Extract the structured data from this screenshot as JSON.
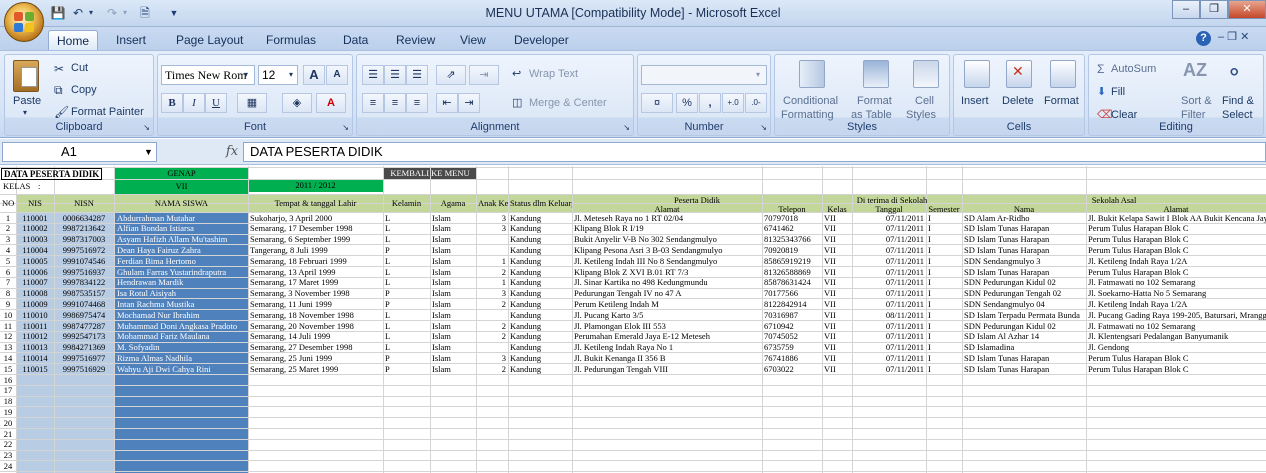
{
  "window": {
    "title": "MENU UTAMA  [Compatibility Mode] - Microsoft Excel",
    "minimize": "–",
    "restore": "❐",
    "close": "✕"
  },
  "ribbon_tabs": [
    "Home",
    "Insert",
    "Page Layout",
    "Formulas",
    "Data",
    "Review",
    "View",
    "Developer"
  ],
  "clipboard": {
    "paste": "Paste",
    "cut": "Cut",
    "copy": "Copy",
    "format_painter": "Format Painter",
    "title": "Clipboard"
  },
  "font": {
    "name": "Times New Rom",
    "size": "12",
    "title": "Font",
    "bold": "B",
    "italic": "I",
    "underline": "U",
    "grow": "A",
    "shrink": "A"
  },
  "alignment": {
    "wrap": "Wrap Text",
    "merge": "Merge & Center",
    "title": "Alignment"
  },
  "number": {
    "title": "Number",
    "percent": "%",
    "comma": ","
  },
  "styles": {
    "conditional": "Conditional",
    "formatting": "Formatting",
    "format_as": "Format",
    "as_table": "as Table",
    "cell": "Cell",
    "styles_lbl": "Styles",
    "title": "Styles"
  },
  "cells": {
    "insert": "Insert",
    "delete": "Delete",
    "format": "Format",
    "title": "Cells"
  },
  "editing": {
    "autosum": "AutoSum",
    "fill": "Fill",
    "clear": "Clear",
    "sort": "Sort &",
    "filter": "Filter",
    "find": "Find &",
    "select": "Select",
    "title": "Editing"
  },
  "formula_bar": {
    "name_box": "A1",
    "fx": "fx",
    "formula": "DATA PESERTA DIDIK"
  },
  "sheet": {
    "title": "DATA PESERTA DIDIK",
    "kelas_label": "KELAS",
    "kelas_colon": ":",
    "genap": "GENAP",
    "vii": "VII",
    "year": "2011 / 2012",
    "kembali": "KEMBALI KE MENU",
    "headers": {
      "no": "NO",
      "nis": "NIS",
      "nisn": "NISN",
      "nama": "NAMA SISWA",
      "ttl": "Tempat & tanggal Lahir",
      "kelamin": "Kelamin",
      "agama": "Agama",
      "anak": "Anak Ke",
      "status": "Status dlm Keluarga",
      "peserta_didik": "Peserta Didik",
      "alamat": "Alamat",
      "telepon": "Telepon",
      "diterima": "Di terima di Sekolah",
      "kelas": "Kelas",
      "tanggal": "Tanggal",
      "semester": "Semester",
      "sekolah_asal": "Sekolah Asal",
      "nama_sekolah": "Nama",
      "alamat_sekolah": "Alamat"
    },
    "rows": [
      {
        "no": "1",
        "nis": "110001",
        "nisn": "0006634287",
        "nama": "Abdurrahman Mutahar",
        "ttl": "Sukoharjo, 3 April 2000",
        "jk": "L",
        "agama": "Islam",
        "anak": "3",
        "status": "Kandung",
        "alamat": "Jl. Meteseh Raya no 1 RT 02/04",
        "telp": "70797018",
        "kelas": "VII",
        "tgl": "07/11/2011",
        "sem": "I",
        "sekolah": "SD Alam Ar-Ridho",
        "alamat_sekolah": "Jl. Bukit Kelapa Sawit I Blok AA Bukit Kencana Jaya"
      },
      {
        "no": "2",
        "nis": "110002",
        "nisn": "9987213642",
        "nama": "Alfian Bondan Istiarsa",
        "ttl": "Semarang, 17 Desember 1998",
        "jk": "L",
        "agama": "Islam",
        "anak": "3",
        "status": "Kandung",
        "alamat": "Klipang Blok R I/19",
        "telp": "6741462",
        "kelas": "VII",
        "tgl": "07/11/2011",
        "sem": "I",
        "sekolah": "SD Islam Tunas Harapan",
        "alamat_sekolah": "Perum Tulus Harapan Blok C"
      },
      {
        "no": "3",
        "nis": "110003",
        "nisn": "9987317003",
        "nama": "Asyam Hafizh Allam Mu'tashim",
        "ttl": "Semarang, 6 September 1999",
        "jk": "L",
        "agama": "Islam",
        "anak": "",
        "status": "Kandung",
        "alamat": "Bukit Anyelir V-B No 302 Sendangmulyo",
        "telp": "81325343766",
        "kelas": "VII",
        "tgl": "07/11/2011",
        "sem": "I",
        "sekolah": "SD Islam Tunas Harapan",
        "alamat_sekolah": "Perum Tulus Harapan Blok C"
      },
      {
        "no": "4",
        "nis": "110004",
        "nisn": "9997516972",
        "nama": "Dean Haya Fairuz Zahra",
        "ttl": "Tangerang, 8 Juli 1999",
        "jk": "P",
        "agama": "Islam",
        "anak": "",
        "status": "Kandung",
        "alamat": "Klipang Pesona Asri 3 B-03 Sendangmulyo",
        "telp": "70920819",
        "kelas": "VII",
        "tgl": "07/11/2011",
        "sem": "I",
        "sekolah": "SD Islam Tunas Harapan",
        "alamat_sekolah": "Perum Tulus Harapan Blok C"
      },
      {
        "no": "5",
        "nis": "110005",
        "nisn": "9991074546",
        "nama": "Ferdian Bima Hertomo",
        "ttl": "Semarang, 18 Februari 1999",
        "jk": "L",
        "agama": "Islam",
        "anak": "1",
        "status": "Kandung",
        "alamat": "Jl. Ketileng Indah III No 8 Sendangmulyo",
        "telp": "85865919219",
        "kelas": "VII",
        "tgl": "07/11/2011",
        "sem": "I",
        "sekolah": "SDN Sendangmulyo 3",
        "alamat_sekolah": "Jl. Ketileng Indah Raya 1/2A"
      },
      {
        "no": "6",
        "nis": "110006",
        "nisn": "9997516937",
        "nama": "Ghulam Farras Yustarindraputra",
        "ttl": "Semarang, 13 April 1999",
        "jk": "L",
        "agama": "Islam",
        "anak": "2",
        "status": "Kandung",
        "alamat": "Klipang Blok Z XVI B.01 RT 7/3",
        "telp": "81326588869",
        "kelas": "VII",
        "tgl": "07/11/2011",
        "sem": "I",
        "sekolah": "SD Islam Tunas Harapan",
        "alamat_sekolah": "Perum Tulus Harapan Blok C"
      },
      {
        "no": "7",
        "nis": "110007",
        "nisn": "9997834122",
        "nama": "Hendrawan Mardik",
        "ttl": "Semarang, 17 Maret 1999",
        "jk": "L",
        "agama": "Islam",
        "anak": "1",
        "status": "Kandung",
        "alamat": "Jl. Sinar Kartika no 498 Kedungmundu",
        "telp": "85878631424",
        "kelas": "VII",
        "tgl": "07/11/2011",
        "sem": "I",
        "sekolah": "SDN Pedurungan Kidul 02",
        "alamat_sekolah": "Jl. Fatmawati no 102 Semarang"
      },
      {
        "no": "8",
        "nis": "110008",
        "nisn": "9987535157",
        "nama": "Isa Rotul Aisiyah",
        "ttl": "Semarang, 3 November 1998",
        "jk": "P",
        "agama": "Islam",
        "anak": "3",
        "status": "Kandung",
        "alamat": "Pedurungan Tengah IV no 47 A",
        "telp": "70177566",
        "kelas": "VII",
        "tgl": "07/11/2011",
        "sem": "I",
        "sekolah": "SDN Pedurungan Tengah 02",
        "alamat_sekolah": "Jl. Soekarno-Hatta No 5 Semarang"
      },
      {
        "no": "9",
        "nis": "110009",
        "nisn": "9991074468",
        "nama": "Intan Rachma Mustika",
        "ttl": "Semarang, 11 Juni 1999",
        "jk": "P",
        "agama": "Islam",
        "anak": "2",
        "status": "Kandung",
        "alamat": "Perum Ketileng Indah M",
        "telp": "8122842914",
        "kelas": "VII",
        "tgl": "07/11/2011",
        "sem": "I",
        "sekolah": "SDN Sendangmulyo 04",
        "alamat_sekolah": "Jl. Ketileng Indah Raya 1/2A"
      },
      {
        "no": "10",
        "nis": "110010",
        "nisn": "9986975474",
        "nama": "Mochamad Nur Ibrahim",
        "ttl": "Semarang, 18 November 1998",
        "jk": "L",
        "agama": "Islam",
        "anak": "",
        "status": "Kandung",
        "alamat": "Jl. Pucang Karto 3/5",
        "telp": "70316987",
        "kelas": "VII",
        "tgl": "08/11/2011",
        "sem": "I",
        "sekolah": "SD Islam Terpadu Permata Bunda",
        "alamat_sekolah": "Jl. Pucang Gading Raya 199-205, Batursari, Mranggen"
      },
      {
        "no": "11",
        "nis": "110011",
        "nisn": "9987477287",
        "nama": "Muhammad Doni Angkasa Pradoto",
        "ttl": "Semarang, 20 November 1998",
        "jk": "L",
        "agama": "Islam",
        "anak": "2",
        "status": "Kandung",
        "alamat": "Jl. Plamongan Elok III 553",
        "telp": "6710942",
        "kelas": "VII",
        "tgl": "07/11/2011",
        "sem": "I",
        "sekolah": "SDN Pedurungan Kidul 02",
        "alamat_sekolah": "Jl. Fatmawati no 102 Semarang"
      },
      {
        "no": "12",
        "nis": "110012",
        "nisn": "9992547173",
        "nama": "Mohammad Fariz Maulana",
        "ttl": "Semarang, 14 Juli 1999",
        "jk": "L",
        "agama": "Islam",
        "anak": "2",
        "status": "Kandung",
        "alamat": "Perumahan Emerald Jaya E-12 Meteseh",
        "telp": "70745052",
        "kelas": "VII",
        "tgl": "07/11/2011",
        "sem": "I",
        "sekolah": "SD Islam Al Azhar 14",
        "alamat_sekolah": "Jl. Klentengsari Pedalangan Banyumanik"
      },
      {
        "no": "13",
        "nis": "110013",
        "nisn": "9984271369",
        "nama": "M. Sofyadin",
        "ttl": "Semarang, 27 Desember 1998",
        "jk": "L",
        "agama": "Islam",
        "anak": "",
        "status": "Kandung",
        "alamat": "Jl. Ketileng Indah Raya No 1",
        "telp": "6735759",
        "kelas": "VII",
        "tgl": "07/11/2011",
        "sem": "I",
        "sekolah": "SD Islamadina",
        "alamat_sekolah": "Jl. Gendong"
      },
      {
        "no": "14",
        "nis": "110014",
        "nisn": "9997516977",
        "nama": "Rizma Almas Nadhila",
        "ttl": "Semarang, 25 Juni 1999",
        "jk": "P",
        "agama": "Islam",
        "anak": "3",
        "status": "Kandung",
        "alamat": "Jl. Bukit Kenanga II 356 B",
        "telp": "76741886",
        "kelas": "VII",
        "tgl": "07/11/2011",
        "sem": "I",
        "sekolah": "SD Islam Tunas Harapan",
        "alamat_sekolah": "Perum Tulus Harapan Blok C"
      },
      {
        "no": "15",
        "nis": "110015",
        "nisn": "9997516929",
        "nama": "Wahyu Aji Dwi Cahya Rini",
        "ttl": "Semarang, 25 Maret 1999",
        "jk": "P",
        "agama": "Islam",
        "anak": "2",
        "status": "Kandung",
        "alamat": "Jl. Pedurungan Tengah VIII",
        "telp": "6703022",
        "kelas": "VII",
        "tgl": "07/11/2011",
        "sem": "I",
        "sekolah": "SD Islam Tunas Harapan",
        "alamat_sekolah": "Perum Tulus Harapan Blok C"
      }
    ],
    "empty_rows": [
      "16",
      "17",
      "18",
      "19",
      "20",
      "21",
      "22",
      "23",
      "24"
    ]
  },
  "colors": {
    "green": "#2cb24a",
    "blue_col": "#95b3d7",
    "dark_blue": "#4f81bd",
    "kembali_bg": "#4a4a4a",
    "header_green": "#c4d79b"
  }
}
